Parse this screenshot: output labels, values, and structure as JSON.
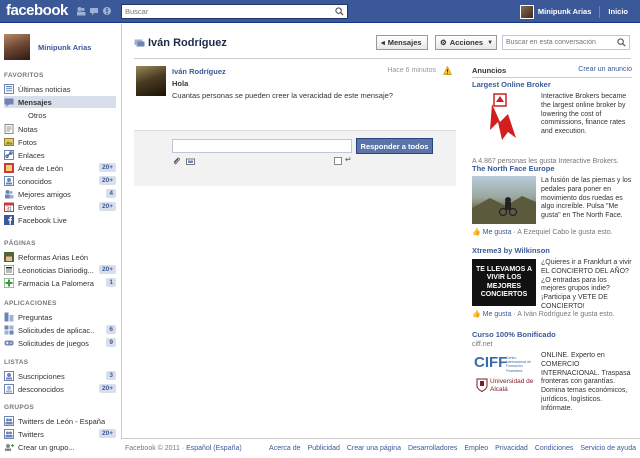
{
  "topbar": {
    "logo": "facebook",
    "search_placeholder": "Buscar",
    "user_name": "Minipunk Arias",
    "home_label": "Inicio"
  },
  "sidebar": {
    "profile_name": "Minipunk Arias",
    "favorites_title": "FAVORITOS",
    "favorites": [
      {
        "label": "Últimas noticias",
        "icon": "news-feed-icon",
        "count": ""
      },
      {
        "label": "Mensajes",
        "icon": "messages-icon",
        "count": "",
        "active": true
      },
      {
        "label": "Notas",
        "icon": "notes-icon",
        "count": ""
      },
      {
        "label": "Fotos",
        "icon": "photos-icon",
        "count": ""
      },
      {
        "label": "Enlaces",
        "icon": "links-icon",
        "count": ""
      },
      {
        "label": "Área de León",
        "icon": "group-icon",
        "count": "20+"
      },
      {
        "label": "conocidos",
        "icon": "list-icon",
        "count": "20+"
      },
      {
        "label": "Mejores amigos",
        "icon": "friends-icon",
        "count": "4"
      },
      {
        "label": "Eventos",
        "icon": "events-icon",
        "count": "20+"
      },
      {
        "label": "Facebook Live",
        "icon": "facebook-icon",
        "count": ""
      }
    ],
    "messages_sub": "Otros",
    "pages_title": "PÁGINAS",
    "pages": [
      {
        "label": "Reformas Arias León",
        "count": ""
      },
      {
        "label": "Leonoticias Diariodig...",
        "count": "20+"
      },
      {
        "label": "Farmacia La Palomera",
        "count": "1"
      }
    ],
    "apps_title": "APLICACIONES",
    "apps": [
      {
        "label": "Preguntas",
        "count": ""
      },
      {
        "label": "Solicitudes de aplicac...",
        "count": "6"
      },
      {
        "label": "Solicitudes de juegos",
        "count": "9"
      }
    ],
    "lists_title": "LISTAS",
    "lists": [
      {
        "label": "Suscripciones",
        "count": "3"
      },
      {
        "label": "desconocidos",
        "count": "20+"
      }
    ],
    "groups_title": "GRUPOS",
    "groups": [
      {
        "label": "Twitters de León - España",
        "count": ""
      },
      {
        "label": "Twitters",
        "count": "20+"
      },
      {
        "label": "Crear un grupo...",
        "count": ""
      }
    ]
  },
  "conversation": {
    "title": "Iván Rodríguez",
    "messages_button": "Mensajes",
    "actions_button": "Acciones",
    "search_placeholder": "Buscar en esta conversación",
    "message": {
      "from": "Iván Rodríguez",
      "time": "Hace 6 minutos",
      "subject": "Hola",
      "body": "Cuantas personas se pueden creer la veracidad de este mensaje?"
    },
    "reply_button": "Responder a todos",
    "enter_glyph": "↵"
  },
  "ads": {
    "title": "Anuncios",
    "create_label": "Crear un anuncio",
    "items": [
      {
        "title": "Largest Online Broker",
        "text": "Interactive Brokers became the largest online broker by lowering the cost of commissions, finance rates and execution.",
        "like": "A 4.867 personas les gusta Interactive Brokers."
      },
      {
        "title": "The North Face Europe",
        "text": "La fusión de las piernas y los pedales para poner en movimiento dos ruedas es algo increíble. Pulsa \"Me gusta\" en The North Face.",
        "like_link": "Me gusta",
        "like": " · A Ezequiel Cabo le gusta esto."
      },
      {
        "title": "Xtreme3 by Wilkinson",
        "image_text": "TE LLEVAMOS A VIVIR LOS MEJORES CONCIERTOS",
        "text": "¿Quieres ir a Frankfurt a vivir EL CONCIERTO DEL AÑO? ¿O entradas para los mejores grupos indie? ¡Participa y VETE DE CONCIERTO!",
        "like_link": "Me gusta",
        "like": " · A Iván Rodríguez le gusta esto."
      },
      {
        "title": "Curso 100% Bonificado",
        "subtitle": "ciff.net",
        "logo_text": "CIFF",
        "logo_sub": "Centro Internacional de Formación Financiera",
        "logo_uni": "Universidad de Alcalá",
        "text": "ONLINE. Experto en COMERCIO INTERNACIONAL. Traspasa fronteras con garantías. Domina temas económicos, jurídicos, logísticos. Infórmate."
      }
    ]
  },
  "footer": {
    "copyright": "Facebook © 2011 · ",
    "language": "Español (España)",
    "links": [
      "Acerca de",
      "Publicidad",
      "Crear una página",
      "Desarrolladores",
      "Empleo",
      "Privacidad",
      "Condiciones",
      "Servicio de ayuda"
    ]
  },
  "colors": {
    "brand": "#3b5998",
    "button": "#5b74a8",
    "badge_bg": "#d8dfea"
  }
}
